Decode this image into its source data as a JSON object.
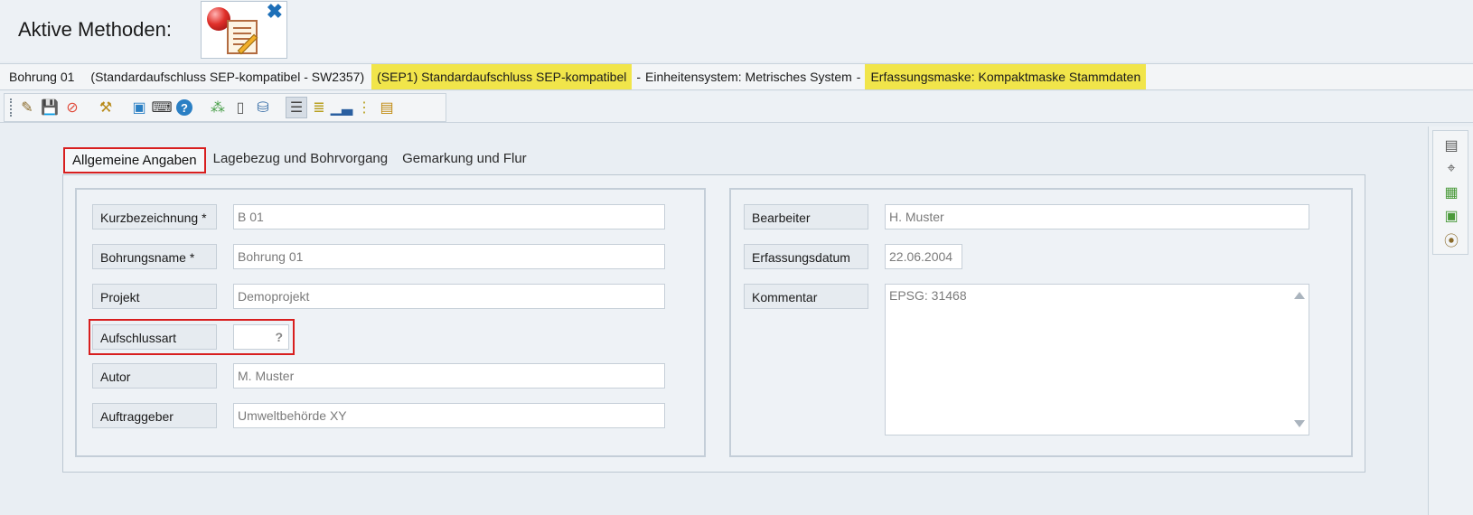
{
  "header": {
    "title": "Aktive Methoden:"
  },
  "infobar": {
    "item1": "Bohrung 01",
    "item2": "(Standardaufschluss SEP-kompatibel - SW2357)",
    "item3": "(SEP1) Standardaufschluss SEP-kompatibel",
    "sep1": "-",
    "item4": "Einheitensystem: Metrisches System",
    "sep2": "-",
    "item5": "Erfassungsmaske: Kompaktmaske Stammdaten",
    "highlight_color": "#f1e54a"
  },
  "tabs": [
    {
      "label": "Allgemeine Angaben"
    },
    {
      "label": "Lagebezug und Bohrvorgang"
    },
    {
      "label": "Gemarkung und Flur"
    }
  ],
  "left_form": {
    "kurzbezeichnung": {
      "label": "Kurzbezeichnung *",
      "value": "B 01"
    },
    "bohrungsname": {
      "label": "Bohrungsname *",
      "value": "Bohrung 01"
    },
    "projekt": {
      "label": "Projekt",
      "value": "Demoprojekt"
    },
    "aufschlussart": {
      "label": "Aufschlussart",
      "value": "",
      "button": "?"
    },
    "autor": {
      "label": "Autor",
      "value": "M. Muster"
    },
    "auftraggeber": {
      "label": "Auftraggeber",
      "value": "Umweltbehörde XY"
    }
  },
  "right_form": {
    "bearbeiter": {
      "label": "Bearbeiter",
      "value": "H. Muster"
    },
    "erfassungsdatum": {
      "label": "Erfassungsdatum",
      "value": "22.06.2004"
    },
    "kommentar": {
      "label": "Kommentar",
      "value": "EPSG: 31468"
    }
  },
  "colors": {
    "highlight_border": "#d81e1e",
    "accent_blue": "#1d6fb8"
  }
}
